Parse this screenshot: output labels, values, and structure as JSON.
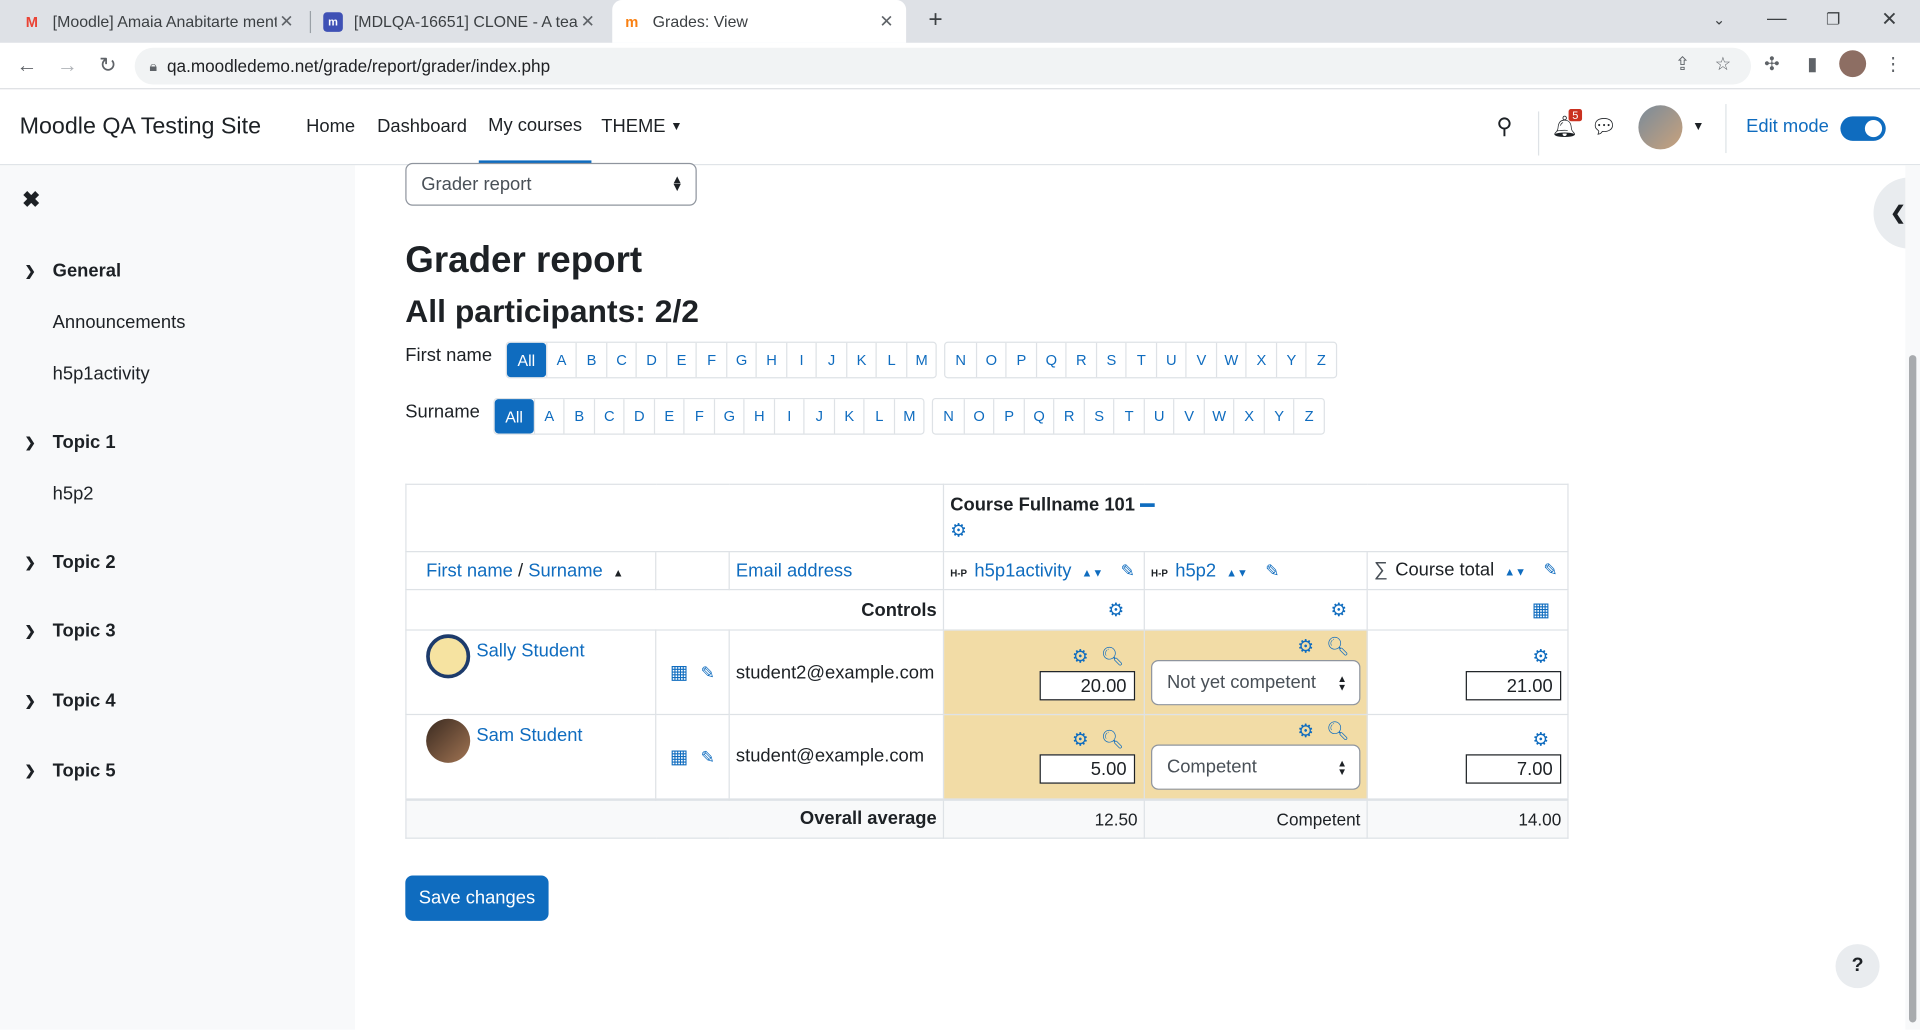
{
  "browser": {
    "tabs": [
      {
        "title": "[Moodle] Amaia Anabitarte ment",
        "icon": "gmail-icon",
        "color": "#ea4335"
      },
      {
        "title": "[MDLQA-16651] CLONE - A teach",
        "icon": "tracker-icon",
        "color": "#3f51b5"
      },
      {
        "title": "Grades: View",
        "icon": "moodle-icon",
        "color": "#f98012"
      }
    ],
    "url": "qa.moodledemo.net/grade/report/grader/index.php"
  },
  "navbar": {
    "brand": "Moodle QA Testing Site",
    "items": [
      "Home",
      "Dashboard",
      "My courses",
      "THEME"
    ],
    "notification_count": "5",
    "edit_mode_label": "Edit mode"
  },
  "drawer": {
    "sections": [
      {
        "title": "General",
        "items": [
          "Announcements",
          "h5p1activity"
        ]
      },
      {
        "title": "Topic 1",
        "items": [
          "h5p2"
        ]
      },
      {
        "title": "Topic 2",
        "items": []
      },
      {
        "title": "Topic 3",
        "items": []
      },
      {
        "title": "Topic 4",
        "items": []
      },
      {
        "title": "Topic 5",
        "items": []
      }
    ]
  },
  "main": {
    "report_select": "Grader report",
    "title": "Grader report",
    "participants": "All participants: 2/2",
    "firstname_label": "First name",
    "surname_label": "Surname",
    "all_label": "All",
    "letters": [
      "A",
      "B",
      "C",
      "D",
      "E",
      "F",
      "G",
      "H",
      "I",
      "J",
      "K",
      "L",
      "M",
      "N",
      "O",
      "P",
      "Q",
      "R",
      "S",
      "T",
      "U",
      "V",
      "W",
      "X",
      "Y",
      "Z"
    ],
    "table": {
      "course_name": "Course Fullname 101",
      "col_firstname": "First name",
      "col_sep": " / ",
      "col_surname": "Surname",
      "col_email": "Email address",
      "col_h5p1": "h5p1activity",
      "col_h5p2": "h5p2",
      "col_total": "Course total",
      "h5p_badge": "H-P",
      "controls": "Controls",
      "rows": [
        {
          "name": "Sally Student",
          "email": "student2@example.com",
          "h5p1": "20.00",
          "h5p2": "Not yet competent",
          "total": "21.00",
          "highlight": "#f2dca6"
        },
        {
          "name": "Sam Student",
          "email": "student@example.com",
          "h5p1": "5.00",
          "h5p2": "Competent",
          "total": "7.00",
          "highlight": "#f2dca6"
        }
      ],
      "avg_label": "Overall average",
      "avg_h5p1": "12.50",
      "avg_h5p2": "Competent",
      "avg_total": "14.00"
    },
    "save_label": "Save changes",
    "help_label": "?"
  }
}
